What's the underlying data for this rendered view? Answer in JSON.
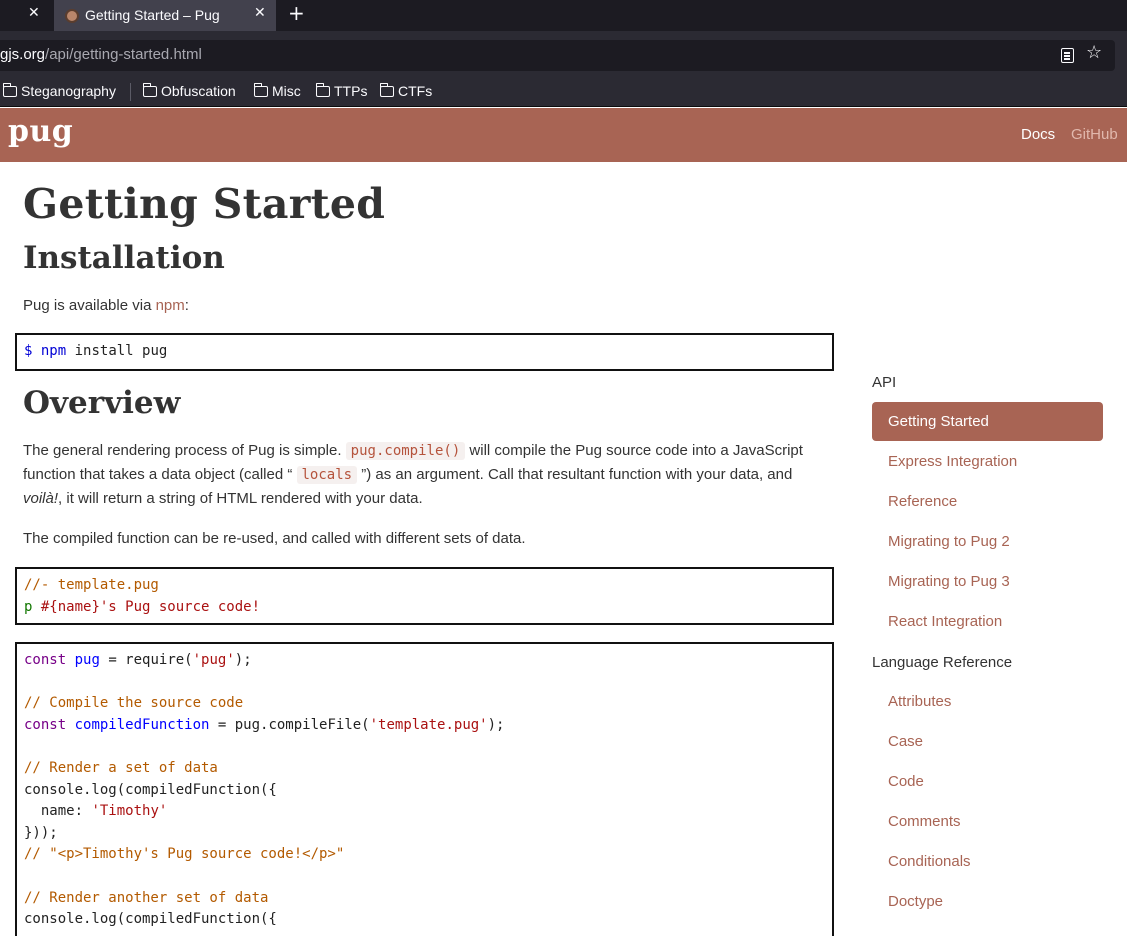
{
  "browser": {
    "tab_title": "Getting Started – Pug",
    "url_host": "gjs.org",
    "url_path": "/api/getting-started.html",
    "bookmarks": [
      "Steganography",
      "Obfuscation",
      "Misc",
      "TTPs",
      "CTFs"
    ]
  },
  "site": {
    "logo": "pug",
    "nav": {
      "docs": "Docs",
      "github": "GitHub"
    }
  },
  "main": {
    "title": "Getting Started",
    "installation_heading": "Installation",
    "install_text_prefix": "Pug is available via ",
    "install_link": "npm",
    "install_text_suffix": ":",
    "install_cmd_prompt": "$",
    "install_cmd_npm": "npm",
    "install_cmd_rest": " install pug",
    "overview_heading": "Overview",
    "overview_p1_a": "The general rendering process of Pug is simple. ",
    "overview_p1_code1": "pug.compile()",
    "overview_p1_b": " will compile the Pug source code into a JavaScript function that takes a data object (called “ ",
    "overview_p1_code2": "locals",
    "overview_p1_c": " ”) as an argument. Call that resultant function with your data, and ",
    "overview_p1_em": "voilà!",
    "overview_p1_d": ", it will return a string of HTML rendered with your data.",
    "overview_p2": "The compiled function can be re-used, and called with different sets of data.",
    "template_comment": "//- template.pug",
    "template_tag": "p",
    "template_body": " #{name}'s Pug source code!",
    "js": {
      "l1_kw": "const",
      "l1_def": "pug",
      "l1_a": " = require(",
      "l1_str": "'pug'",
      "l1_b": ");",
      "l3_comment": "// Compile the source code",
      "l4_kw": "const",
      "l4_def": "compiledFunction",
      "l4_a": " = pug.compileFile(",
      "l4_str": "'template.pug'",
      "l4_b": ");",
      "l6_comment": "// Render a set of data",
      "l7": "console.log(compiledFunction({",
      "l8_a": "  name: ",
      "l8_str": "'Timothy'",
      "l9": "}));",
      "l10_comment": "// \"<p>Timothy's Pug source code!</p>\"",
      "l12_comment": "// Render another set of data",
      "l13": "console.log(compiledFunction({"
    }
  },
  "sidebar": {
    "api_heading": "API",
    "api_items": [
      "Getting Started",
      "Express Integration",
      "Reference",
      "Migrating to Pug 2",
      "Migrating to Pug 3",
      "React Integration"
    ],
    "lang_heading": "Language Reference",
    "lang_items": [
      "Attributes",
      "Case",
      "Code",
      "Comments",
      "Conditionals",
      "Doctype"
    ]
  }
}
